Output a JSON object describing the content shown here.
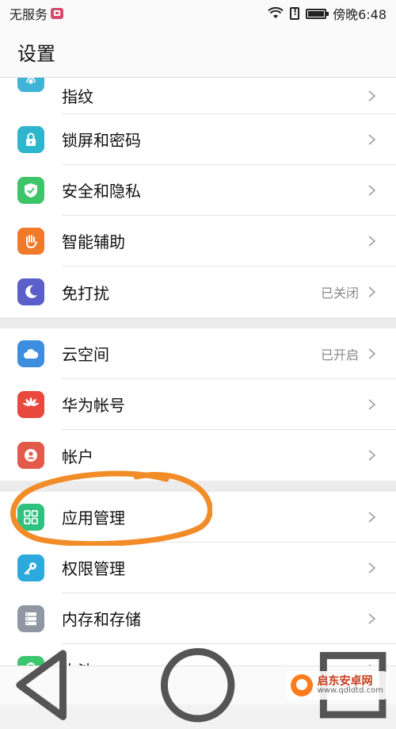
{
  "status": {
    "carrier": "无服务",
    "time": "傍晚6:48"
  },
  "title": "设置",
  "groups": [
    {
      "items": [
        {
          "label": "指纹",
          "icon": "fingerprint-icon",
          "color": "#3fb4d6"
        },
        {
          "label": "锁屏和密码",
          "icon": "lock-icon",
          "color": "#2fb6cf"
        },
        {
          "label": "安全和隐私",
          "icon": "shield-icon",
          "color": "#3ec56a"
        },
        {
          "label": "智能辅助",
          "icon": "hand-icon",
          "color": "#f07a2a"
        },
        {
          "label": "免打扰",
          "icon": "moon-icon",
          "color": "#5b5fc9",
          "value": "已关闭"
        }
      ]
    },
    {
      "items": [
        {
          "label": "云空间",
          "icon": "cloud-icon",
          "color": "#3e8ee0",
          "value": "已开启"
        },
        {
          "label": "华为帐号",
          "icon": "huawei-logo-icon",
          "color": "#e9483c"
        },
        {
          "label": "帐户",
          "icon": "account-icon",
          "color": "#e35a4a"
        }
      ]
    },
    {
      "items": [
        {
          "label": "应用管理",
          "icon": "apps-grid-icon",
          "color": "#2ec27e"
        },
        {
          "label": "权限管理",
          "icon": "key-icon",
          "color": "#2ca9dd"
        },
        {
          "label": "内存和存储",
          "icon": "storage-icon",
          "color": "#8f97a3"
        },
        {
          "label": "电池",
          "icon": "battery-tile-icon",
          "color": "#3cc66f"
        }
      ]
    }
  ],
  "watermark": {
    "name": "启东安卓网",
    "url": "www.qdldtd.com"
  },
  "colors": {
    "annotation": "#f28c28",
    "chevron": "#9a9a9a"
  }
}
